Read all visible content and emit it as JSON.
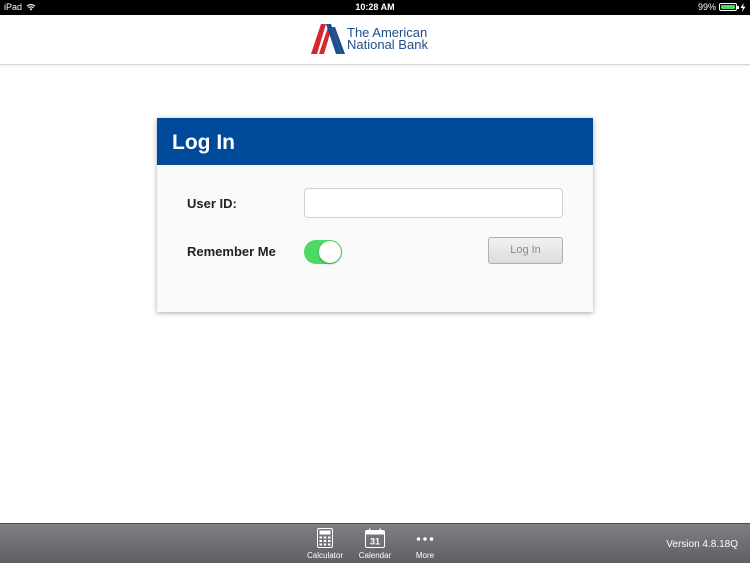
{
  "status_bar": {
    "device": "iPad",
    "time": "10:28 AM",
    "battery": "99%",
    "battery_level": 0.99
  },
  "header": {
    "logo_line1": "The American",
    "logo_line2": "National Bank"
  },
  "login_card": {
    "title": "Log In",
    "userid_label": "User ID:",
    "userid_value": "",
    "remember_label": "Remember Me",
    "remember_on": true,
    "login_button_label": "Log In"
  },
  "toolbar": {
    "items": [
      {
        "label": "Calculator",
        "icon": "calculator-icon"
      },
      {
        "label": "Calendar",
        "icon": "calendar-icon",
        "icon_text": "31"
      },
      {
        "label": "More",
        "icon": "more-icon"
      }
    ],
    "version": "Version 4.8.18Q"
  },
  "colors": {
    "brand_blue": "#004a9b",
    "logo_red": "#d7262e",
    "toggle_green": "#4cd964"
  }
}
